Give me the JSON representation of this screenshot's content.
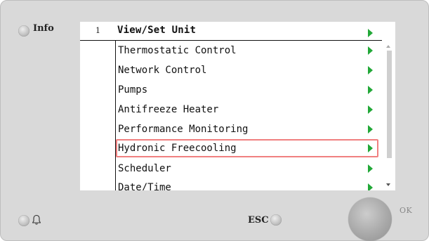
{
  "device": {
    "info_label": "Info",
    "esc_label": "ESC",
    "ok_label": "OK"
  },
  "screen": {
    "level": "1",
    "menu_title": "View/Set Unit",
    "items": [
      {
        "label": "Thermostatic Control",
        "arrow_icon": "right-arrow-icon"
      },
      {
        "label": "Network Control",
        "arrow_icon": "right-arrow-icon"
      },
      {
        "label": "Pumps",
        "arrow_icon": "right-arrow-icon"
      },
      {
        "label": "Antifreeze Heater",
        "arrow_icon": "right-arrow-icon"
      },
      {
        "label": "Performance Monitoring",
        "arrow_icon": "right-arrow-icon"
      },
      {
        "label": "Hydronic Freecooling",
        "arrow_icon": "right-arrow-icon",
        "selected": true
      },
      {
        "label": "Scheduler",
        "arrow_icon": "right-arrow-icon"
      },
      {
        "label": "Date/Time",
        "arrow_icon": "right-arrow-icon"
      }
    ]
  },
  "colors": {
    "panel_bg": "#d9d9d9",
    "arrow_green": "#22a838",
    "selection_border": "#f08080"
  },
  "icons": [
    "bell-icon",
    "scroll-up-icon",
    "scroll-down-icon"
  ]
}
